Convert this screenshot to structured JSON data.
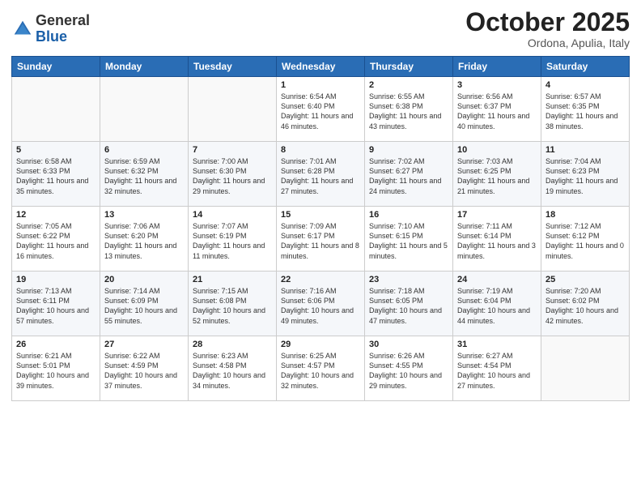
{
  "logo": {
    "general": "General",
    "blue": "Blue"
  },
  "header": {
    "title": "October 2025",
    "location": "Ordona, Apulia, Italy"
  },
  "columns": [
    "Sunday",
    "Monday",
    "Tuesday",
    "Wednesday",
    "Thursday",
    "Friday",
    "Saturday"
  ],
  "weeks": [
    [
      {
        "day": "",
        "text": ""
      },
      {
        "day": "",
        "text": ""
      },
      {
        "day": "",
        "text": ""
      },
      {
        "day": "1",
        "text": "Sunrise: 6:54 AM\nSunset: 6:40 PM\nDaylight: 11 hours\nand 46 minutes."
      },
      {
        "day": "2",
        "text": "Sunrise: 6:55 AM\nSunset: 6:38 PM\nDaylight: 11 hours\nand 43 minutes."
      },
      {
        "day": "3",
        "text": "Sunrise: 6:56 AM\nSunset: 6:37 PM\nDaylight: 11 hours\nand 40 minutes."
      },
      {
        "day": "4",
        "text": "Sunrise: 6:57 AM\nSunset: 6:35 PM\nDaylight: 11 hours\nand 38 minutes."
      }
    ],
    [
      {
        "day": "5",
        "text": "Sunrise: 6:58 AM\nSunset: 6:33 PM\nDaylight: 11 hours\nand 35 minutes."
      },
      {
        "day": "6",
        "text": "Sunrise: 6:59 AM\nSunset: 6:32 PM\nDaylight: 11 hours\nand 32 minutes."
      },
      {
        "day": "7",
        "text": "Sunrise: 7:00 AM\nSunset: 6:30 PM\nDaylight: 11 hours\nand 29 minutes."
      },
      {
        "day": "8",
        "text": "Sunrise: 7:01 AM\nSunset: 6:28 PM\nDaylight: 11 hours\nand 27 minutes."
      },
      {
        "day": "9",
        "text": "Sunrise: 7:02 AM\nSunset: 6:27 PM\nDaylight: 11 hours\nand 24 minutes."
      },
      {
        "day": "10",
        "text": "Sunrise: 7:03 AM\nSunset: 6:25 PM\nDaylight: 11 hours\nand 21 minutes."
      },
      {
        "day": "11",
        "text": "Sunrise: 7:04 AM\nSunset: 6:23 PM\nDaylight: 11 hours\nand 19 minutes."
      }
    ],
    [
      {
        "day": "12",
        "text": "Sunrise: 7:05 AM\nSunset: 6:22 PM\nDaylight: 11 hours\nand 16 minutes."
      },
      {
        "day": "13",
        "text": "Sunrise: 7:06 AM\nSunset: 6:20 PM\nDaylight: 11 hours\nand 13 minutes."
      },
      {
        "day": "14",
        "text": "Sunrise: 7:07 AM\nSunset: 6:19 PM\nDaylight: 11 hours\nand 11 minutes."
      },
      {
        "day": "15",
        "text": "Sunrise: 7:09 AM\nSunset: 6:17 PM\nDaylight: 11 hours\nand 8 minutes."
      },
      {
        "day": "16",
        "text": "Sunrise: 7:10 AM\nSunset: 6:15 PM\nDaylight: 11 hours\nand 5 minutes."
      },
      {
        "day": "17",
        "text": "Sunrise: 7:11 AM\nSunset: 6:14 PM\nDaylight: 11 hours\nand 3 minutes."
      },
      {
        "day": "18",
        "text": "Sunrise: 7:12 AM\nSunset: 6:12 PM\nDaylight: 11 hours\nand 0 minutes."
      }
    ],
    [
      {
        "day": "19",
        "text": "Sunrise: 7:13 AM\nSunset: 6:11 PM\nDaylight: 10 hours\nand 57 minutes."
      },
      {
        "day": "20",
        "text": "Sunrise: 7:14 AM\nSunset: 6:09 PM\nDaylight: 10 hours\nand 55 minutes."
      },
      {
        "day": "21",
        "text": "Sunrise: 7:15 AM\nSunset: 6:08 PM\nDaylight: 10 hours\nand 52 minutes."
      },
      {
        "day": "22",
        "text": "Sunrise: 7:16 AM\nSunset: 6:06 PM\nDaylight: 10 hours\nand 49 minutes."
      },
      {
        "day": "23",
        "text": "Sunrise: 7:18 AM\nSunset: 6:05 PM\nDaylight: 10 hours\nand 47 minutes."
      },
      {
        "day": "24",
        "text": "Sunrise: 7:19 AM\nSunset: 6:04 PM\nDaylight: 10 hours\nand 44 minutes."
      },
      {
        "day": "25",
        "text": "Sunrise: 7:20 AM\nSunset: 6:02 PM\nDaylight: 10 hours\nand 42 minutes."
      }
    ],
    [
      {
        "day": "26",
        "text": "Sunrise: 6:21 AM\nSunset: 5:01 PM\nDaylight: 10 hours\nand 39 minutes."
      },
      {
        "day": "27",
        "text": "Sunrise: 6:22 AM\nSunset: 4:59 PM\nDaylight: 10 hours\nand 37 minutes."
      },
      {
        "day": "28",
        "text": "Sunrise: 6:23 AM\nSunset: 4:58 PM\nDaylight: 10 hours\nand 34 minutes."
      },
      {
        "day": "29",
        "text": "Sunrise: 6:25 AM\nSunset: 4:57 PM\nDaylight: 10 hours\nand 32 minutes."
      },
      {
        "day": "30",
        "text": "Sunrise: 6:26 AM\nSunset: 4:55 PM\nDaylight: 10 hours\nand 29 minutes."
      },
      {
        "day": "31",
        "text": "Sunrise: 6:27 AM\nSunset: 4:54 PM\nDaylight: 10 hours\nand 27 minutes."
      },
      {
        "day": "",
        "text": ""
      }
    ]
  ]
}
